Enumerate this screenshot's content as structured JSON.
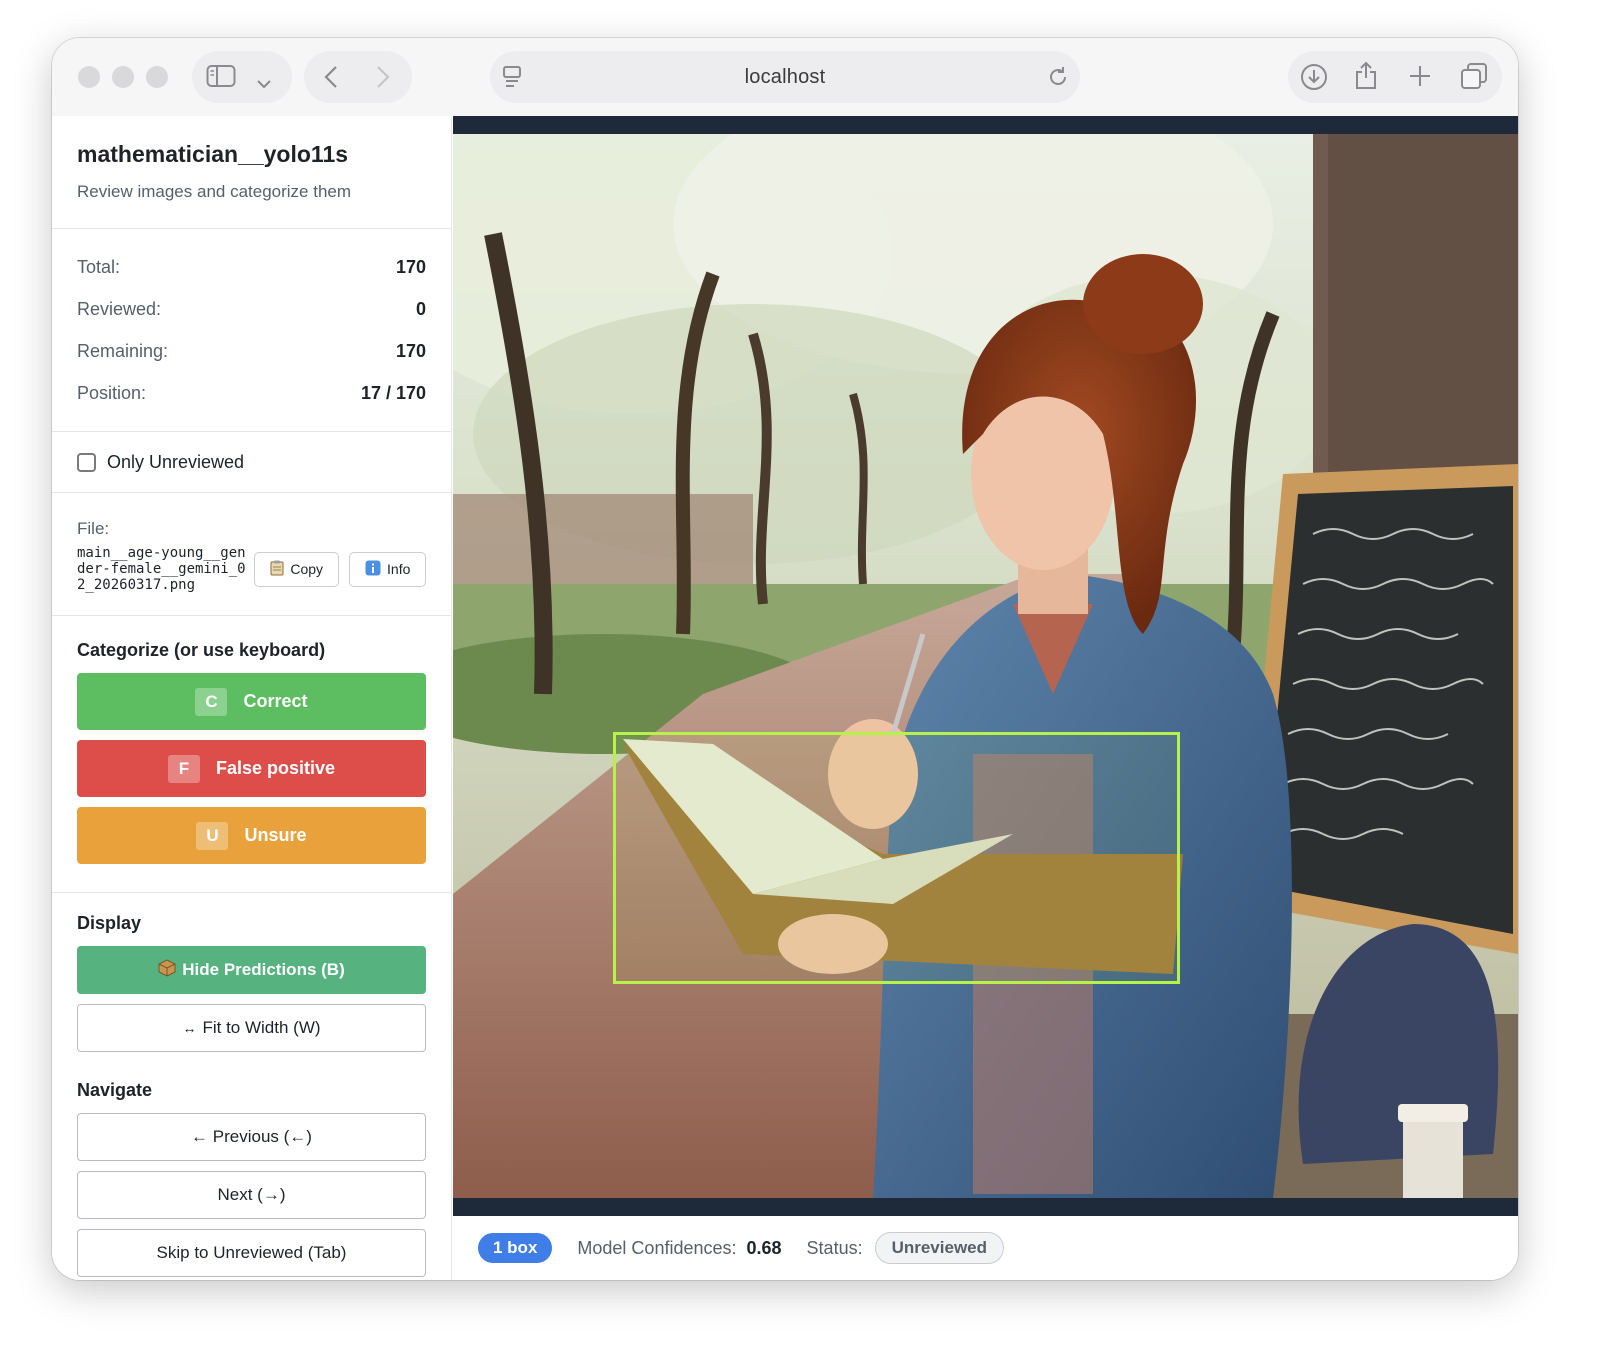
{
  "browser": {
    "url": "localhost"
  },
  "sidebar": {
    "title": "mathematician__yolo11s",
    "subtitle": "Review images and categorize them",
    "stats": [
      {
        "label": "Total:",
        "value": "170"
      },
      {
        "label": "Reviewed:",
        "value": "0"
      },
      {
        "label": "Remaining:",
        "value": "170"
      },
      {
        "label": "Position:",
        "value": "17 / 170"
      }
    ],
    "only_unreviewed": {
      "label": "Only Unreviewed",
      "checked": false
    },
    "file": {
      "label": "File:",
      "name": "main__age-young__gender-female__gemini_02_20260317.png",
      "copy_label": "Copy",
      "copy_icon": "clipboard-icon",
      "info_label": "Info",
      "info_icon": "info-icon"
    },
    "categorize": {
      "heading": "Categorize (or use keyboard)",
      "buttons": [
        {
          "key": "C",
          "label": "Correct",
          "color": "#5cbd61"
        },
        {
          "key": "F",
          "label": "False positive",
          "color": "#dd4e4b"
        },
        {
          "key": "U",
          "label": "Unsure",
          "color": "#e9a23b"
        }
      ]
    },
    "display": {
      "heading": "Display",
      "hide_predictions": "Hide Predictions (B)",
      "hide_icon": "package-icon",
      "fit_width": "Fit to Width (W)",
      "fit_icon": "left-right-arrow-icon"
    },
    "navigate": {
      "heading": "Navigate",
      "previous": "← Previous (←)",
      "next": "Next (→)",
      "skip": "Skip to Unreviewed (Tab)"
    }
  },
  "status_bar": {
    "box_count": "1 box",
    "confidence_label": "Model Confidences:",
    "confidence_value": "0.68",
    "status_label": "Status:",
    "status_value": "Unreviewed"
  },
  "colors": {
    "accent_blue": "#3f7ee8",
    "bbox": "#b6f24a",
    "hide_predictions": "#56b37f"
  }
}
